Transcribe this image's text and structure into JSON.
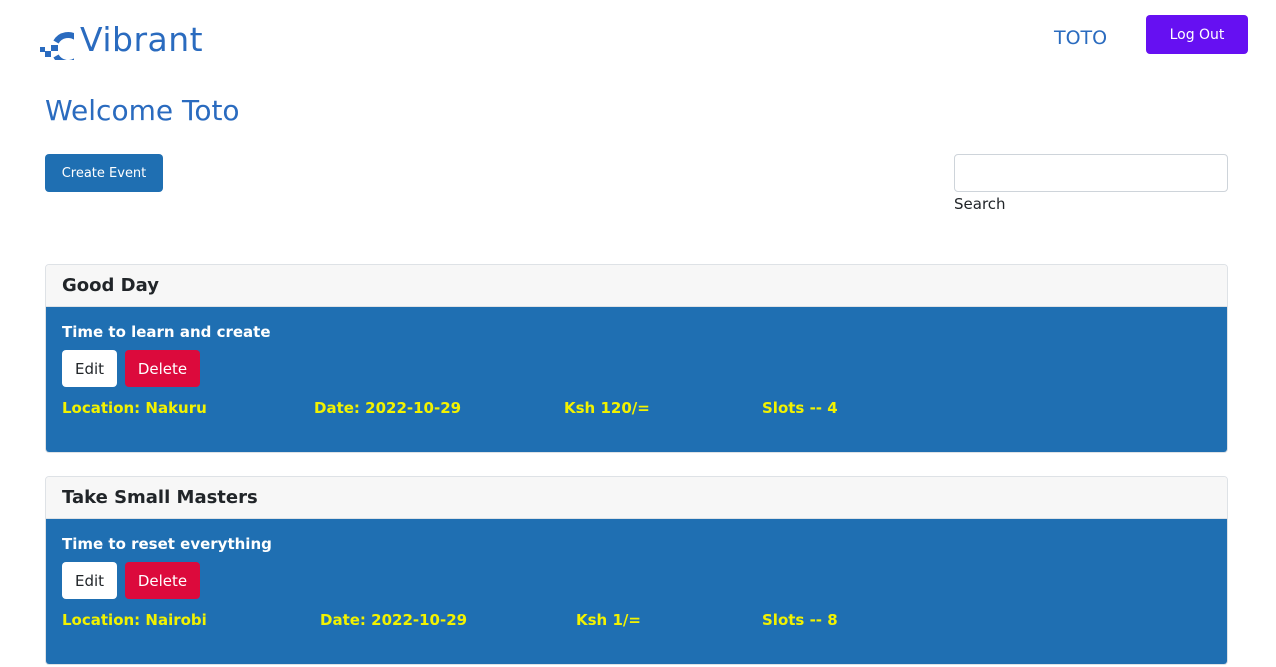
{
  "navbar": {
    "brand": "Vibrant",
    "user": "TOTO",
    "logout_label": "Log Out"
  },
  "page": {
    "welcome": "Welcome Toto",
    "create_label": "Create Event",
    "search_value": "",
    "search_label": "Search"
  },
  "events": [
    {
      "title": "Good Day",
      "description": "Time to learn and create",
      "edit_label": "Edit",
      "delete_label": "Delete",
      "location": "Location: Nakuru",
      "date": "Date: 2022-10-29",
      "price": "Ksh 120/=",
      "slots": "Slots -- 4"
    },
    {
      "title": "Take Small Masters",
      "description": "Time to reset everything",
      "edit_label": "Edit",
      "delete_label": "Delete",
      "location": "Location: Nairobi",
      "date": "Date: 2022-10-29",
      "price": "Ksh 1/=",
      "slots": "Slots -- 8"
    }
  ],
  "colors": {
    "brand": "#2a6bbf",
    "logout": "#6610f2",
    "card_body": "#1f6fb2",
    "delete": "#dc0a3c",
    "meta_text": "#f2f200"
  }
}
